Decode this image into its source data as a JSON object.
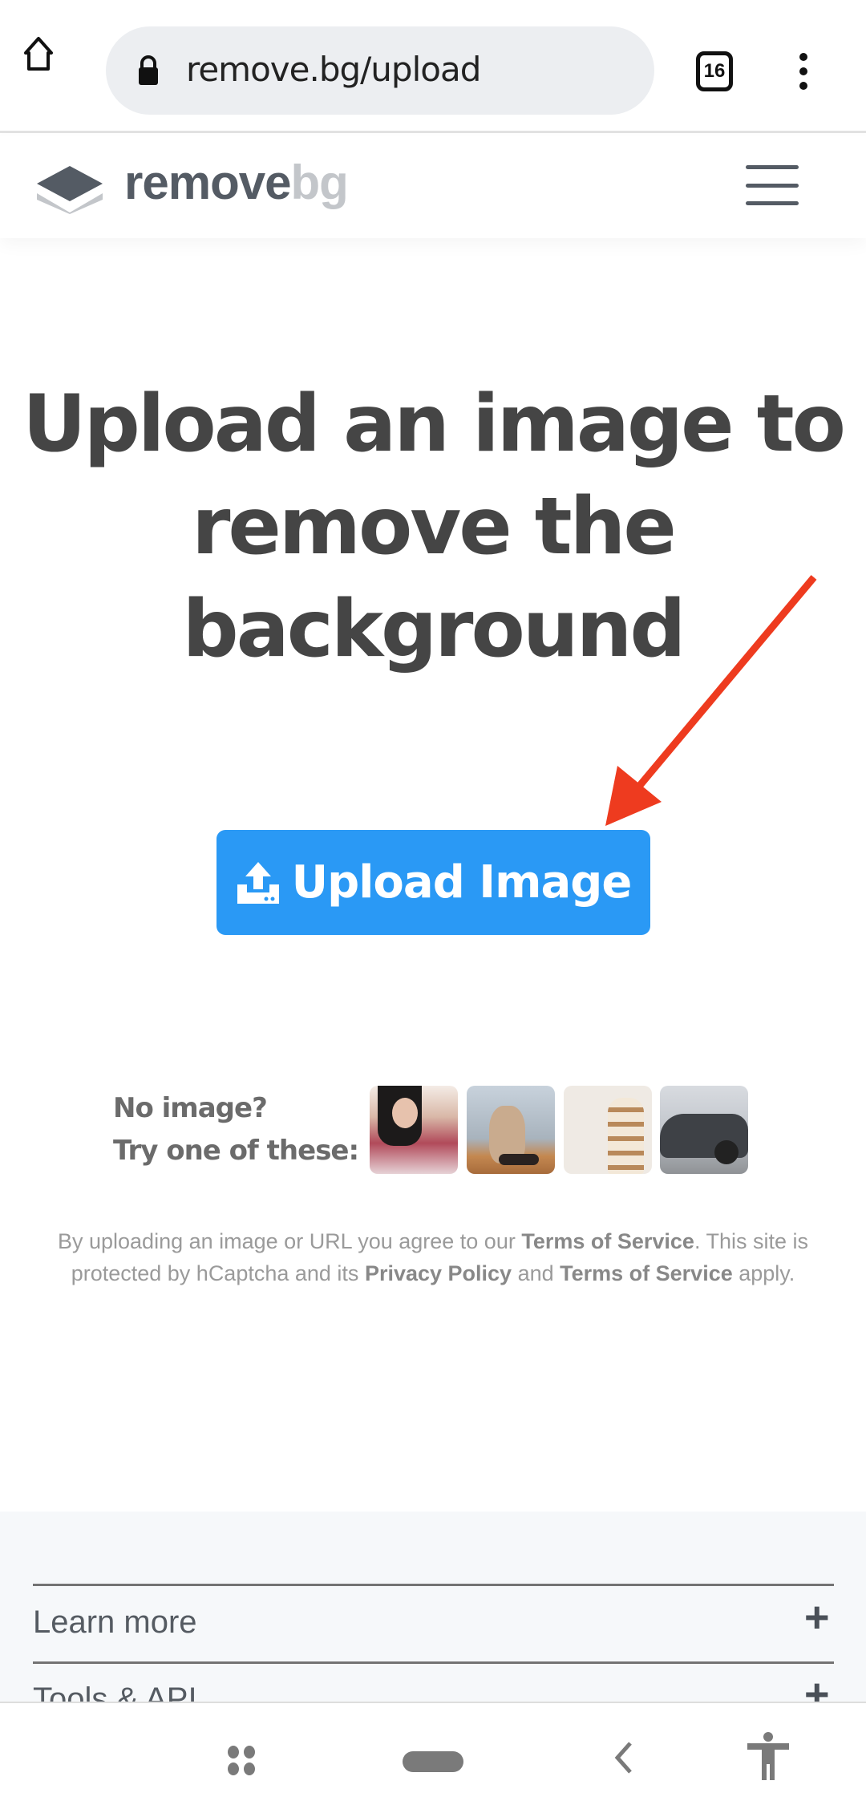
{
  "browser": {
    "url": "remove.bg/upload",
    "tab_count": "16",
    "icons": [
      "home-icon",
      "lock-icon",
      "tabs-icon",
      "more-vert-icon"
    ]
  },
  "header": {
    "logo_main": "remove",
    "logo_accent": "bg",
    "menu_icon": "hamburger-icon"
  },
  "main": {
    "title": "Upload an image to remove the background",
    "upload_button": "Upload Image",
    "upload_button_color": "#2a99f5",
    "annotation_arrow_color": "#ee3b1f",
    "no_image_line1": "No image?",
    "no_image_line2": "Try one of these:",
    "samples": [
      "woman",
      "cat",
      "dessert",
      "car"
    ],
    "terms": {
      "t1": "By uploading an image or URL you agree to our ",
      "tos1": "Terms of Service",
      "t2": ". This site is protected by hCaptcha and its ",
      "privacy": "Privacy Policy",
      "t3": " and ",
      "tos2": "Terms of Service",
      "t4": " apply."
    }
  },
  "footer": {
    "items": [
      {
        "label": "Learn more"
      },
      {
        "label": "Tools & API"
      }
    ]
  },
  "nav": {
    "icons": [
      "apps-icon",
      "home-pill-icon",
      "back-icon",
      "accessibility-icon"
    ]
  }
}
